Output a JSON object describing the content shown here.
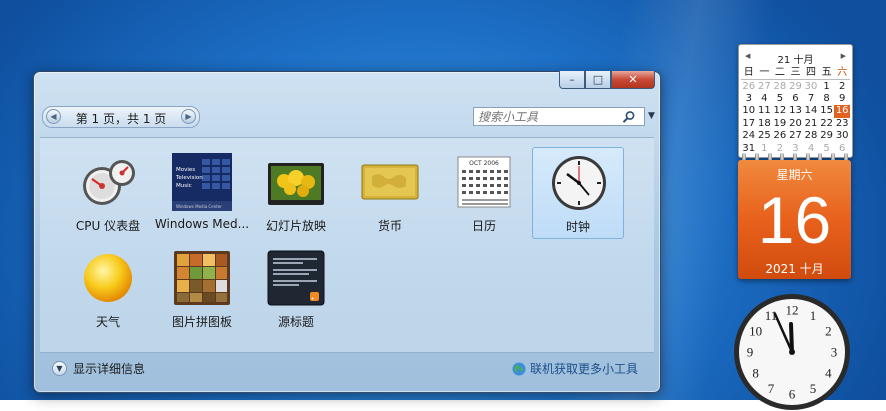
{
  "window": {
    "pager_text": "第 1 页，共 1 页",
    "search_placeholder": "搜索小工具",
    "caption": {
      "minimize": "–",
      "maximize": "□",
      "close": "✕"
    },
    "gadgets": [
      {
        "label": "CPU 仪表盘",
        "icon": "cpu-meter-icon",
        "selected": false
      },
      {
        "label": "Windows Med...",
        "icon": "windows-media-center-icon",
        "selected": false,
        "preview_lines": [
          "Movies",
          "Television",
          "Music",
          "Windows Media Center"
        ]
      },
      {
        "label": "幻灯片放映",
        "icon": "slideshow-icon",
        "selected": false
      },
      {
        "label": "货币",
        "icon": "currency-icon",
        "selected": false
      },
      {
        "label": "日历",
        "icon": "calendar-icon",
        "selected": false,
        "preview_month": "OCT 2006"
      },
      {
        "label": "时钟",
        "icon": "clock-icon",
        "selected": true
      },
      {
        "label": "天气",
        "icon": "weather-icon",
        "selected": false
      },
      {
        "label": "图片拼图板",
        "icon": "picture-puzzle-icon",
        "selected": false
      },
      {
        "label": "源标题",
        "icon": "feed-headlines-icon",
        "selected": false
      }
    ],
    "footer": {
      "show_details": "显示详细信息",
      "get_more": "联机获取更多小工具"
    }
  },
  "calendar": {
    "month_title": "21 十月",
    "weekdays": [
      "日",
      "一",
      "二",
      "三",
      "四",
      "五",
      "六"
    ],
    "weeks": [
      [
        "26",
        "27",
        "28",
        "29",
        "30",
        "1",
        "2"
      ],
      [
        "3",
        "4",
        "5",
        "6",
        "7",
        "8",
        "9"
      ],
      [
        "10",
        "11",
        "12",
        "13",
        "14",
        "15",
        "16"
      ],
      [
        "17",
        "18",
        "19",
        "20",
        "21",
        "22",
        "23"
      ],
      [
        "24",
        "25",
        "26",
        "27",
        "28",
        "29",
        "30"
      ],
      [
        "31",
        "1",
        "2",
        "3",
        "4",
        "5",
        "6"
      ]
    ],
    "today_weekday": "星期六",
    "today_day": "16",
    "today_year_month": "2021 十月"
  },
  "clock": {
    "hour": 11,
    "minute": 56
  },
  "colors": {
    "accent_orange": "#e8611c",
    "selection": "#7fb1e1",
    "link": "#1b4f8a"
  }
}
